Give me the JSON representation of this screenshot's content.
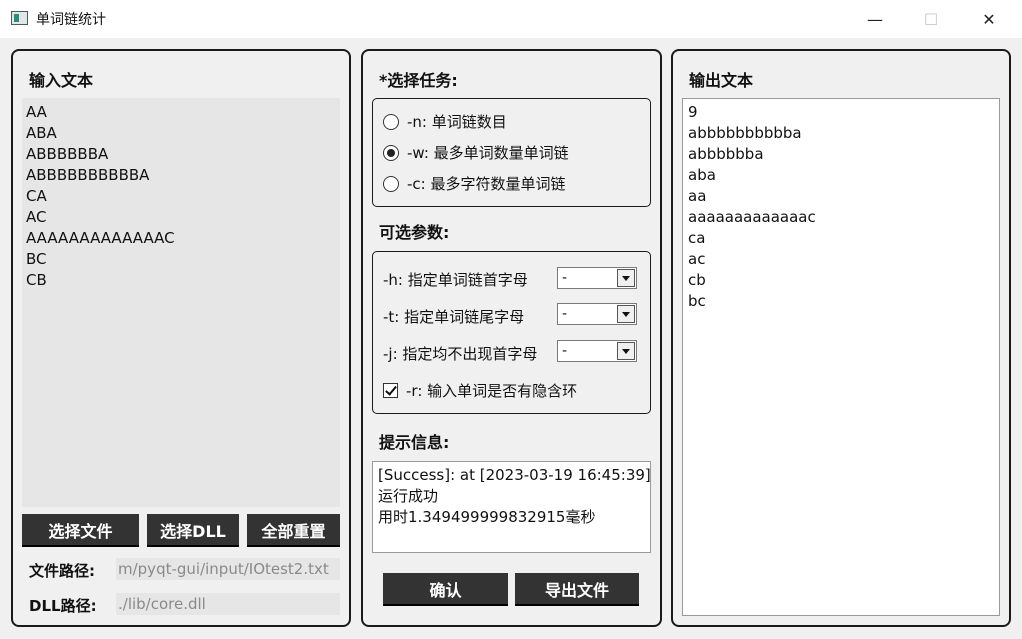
{
  "window": {
    "title": "单词链统计",
    "minimize_glyph": "—",
    "maximize_glyph": "☐",
    "close_glyph": "✕"
  },
  "input_panel": {
    "heading": "输入文本",
    "lines": [
      "AA",
      "ABA",
      "ABBBBBBA",
      "ABBBBBBBBBBA",
      "CA",
      "AC",
      "AAAAAAAAAAAAAC",
      "BC",
      "CB"
    ],
    "buttons": {
      "choose_file": "选择文件",
      "choose_dll": "选择DLL",
      "reset_all": "全部重置"
    },
    "file_path_label": "文件路径:",
    "file_path_value": "m/pyqt-gui/input/IOtest2.txt",
    "dll_path_label": "DLL路径:",
    "dll_path_value": "./lib/core.dll"
  },
  "task_panel": {
    "heading": "*选择任务:",
    "options": [
      {
        "label": "-n: 单词链数目",
        "checked": false
      },
      {
        "label": "-w: 最多单词数量单词链",
        "checked": true
      },
      {
        "label": "-c: 最多字符数量单词链",
        "checked": false
      }
    ],
    "params_heading": "可选参数:",
    "params": [
      {
        "label": "-h: 指定单词链首字母",
        "value": "-"
      },
      {
        "label": "-t: 指定单词链尾字母",
        "value": "-"
      },
      {
        "label": "-j: 指定均不出现首字母",
        "value": "-"
      }
    ],
    "checkbox_label": "-r: 输入单词是否有隐含环",
    "checkbox_checked": true,
    "info_heading": "提示信息:",
    "info_lines": [
      "[Success]: at [2023-03-19 16:45:39]",
      "运行成功",
      "用时1.349499999832915毫秒"
    ],
    "confirm_button": "确认",
    "export_button": "导出文件"
  },
  "output_panel": {
    "heading": "输出文本",
    "lines": [
      "9",
      "abbbbbbbbbba",
      "abbbbbba",
      "aba",
      "aa",
      "aaaaaaaaaaaaac",
      "ca",
      "ac",
      "cb",
      "bc"
    ]
  }
}
